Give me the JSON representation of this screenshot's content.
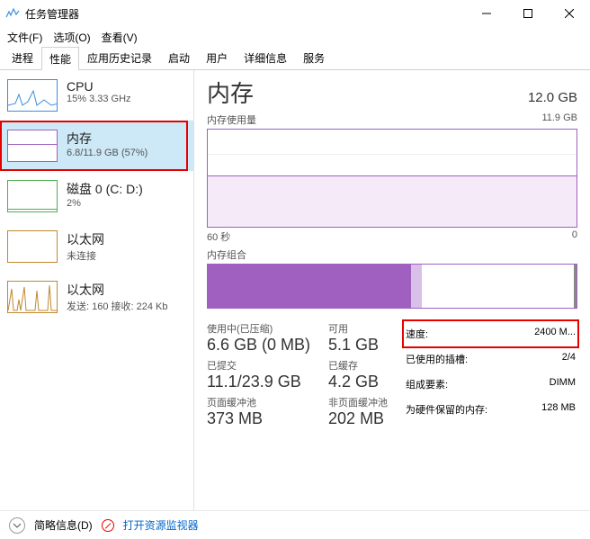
{
  "window": {
    "title": "任务管理器"
  },
  "menu": {
    "file": "文件(F)",
    "options": "选项(O)",
    "view": "查看(V)"
  },
  "tabs": [
    "进程",
    "性能",
    "应用历史记录",
    "启动",
    "用户",
    "详细信息",
    "服务"
  ],
  "activeTab": 1,
  "sidebar": {
    "items": [
      {
        "name": "CPU",
        "sub": "15% 3.33 GHz"
      },
      {
        "name": "内存",
        "sub": "6.8/11.9 GB (57%)"
      },
      {
        "name": "磁盘 0 (C: D:)",
        "sub": "2%"
      },
      {
        "name": "以太网",
        "sub": "未连接"
      },
      {
        "name": "以太网",
        "sub": "发送: 160 接收: 224 Kb"
      }
    ]
  },
  "main": {
    "title": "内存",
    "total": "12.0 GB",
    "usage_label": "内存使用量",
    "usage_max": "11.9 GB",
    "axis_left": "60 秒",
    "axis_right": "0",
    "comp_label": "内存组合",
    "stats_left": [
      {
        "lbl": "使用中(已压缩)",
        "val": "6.6 GB (0 MB)"
      },
      {
        "lbl": "可用",
        "val": "5.1 GB"
      },
      {
        "lbl": "已提交",
        "val": "11.1/23.9 GB"
      },
      {
        "lbl": "已缓存",
        "val": "4.2 GB"
      },
      {
        "lbl": "页面缓冲池",
        "val": "373 MB"
      },
      {
        "lbl": "非页面缓冲池",
        "val": "202 MB"
      }
    ],
    "stats_right": [
      {
        "lbl": "速度:",
        "val": "2400 M..."
      },
      {
        "lbl": "已使用的插槽:",
        "val": "2/4"
      },
      {
        "lbl": "组成要素:",
        "val": "DIMM"
      },
      {
        "lbl": "为硬件保留的内存:",
        "val": "128 MB"
      }
    ]
  },
  "footer": {
    "brief": "简略信息(D)",
    "resmon": "打开资源监视器"
  },
  "chart_data": {
    "type": "area",
    "title": "内存使用量",
    "ylim": [
      0,
      11.9
    ],
    "ylabel": "GB",
    "xlabel": "秒",
    "x_range": [
      -60,
      0
    ],
    "series": [
      {
        "name": "使用中",
        "approx_constant": 6.8
      }
    ]
  }
}
